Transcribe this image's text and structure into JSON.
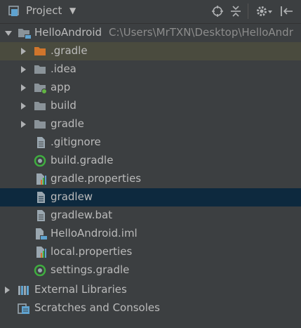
{
  "header": {
    "title": "Project",
    "dropdown_icon": "caret-down-icon",
    "tools": [
      "locate-icon",
      "collapse-all-icon",
      "gear-icon",
      "hide-panel-icon"
    ]
  },
  "tree": {
    "root": {
      "label": "HelloAndroid",
      "path": "C:\\Users\\MrTXN\\Desktop\\HelloAndr"
    },
    "items": [
      {
        "label": ".gradle",
        "icon": "folder-orange-icon"
      },
      {
        "label": ".idea",
        "icon": "folder-icon"
      },
      {
        "label": "app",
        "icon": "module-folder-icon"
      },
      {
        "label": "build",
        "icon": "folder-icon"
      },
      {
        "label": "gradle",
        "icon": "folder-icon"
      },
      {
        "label": ".gitignore",
        "icon": "text-file-icon"
      },
      {
        "label": "build.gradle",
        "icon": "gradle-file-icon"
      },
      {
        "label": "gradle.properties",
        "icon": "properties-file-icon"
      },
      {
        "label": "gradlew",
        "icon": "text-file-icon"
      },
      {
        "label": "gradlew.bat",
        "icon": "text-file-icon"
      },
      {
        "label": "HelloAndroid.iml",
        "icon": "iml-file-icon"
      },
      {
        "label": "local.properties",
        "icon": "properties-file-icon"
      },
      {
        "label": "settings.gradle",
        "icon": "gradle-file-icon"
      }
    ],
    "external_libraries": {
      "label": "External Libraries"
    },
    "scratches": {
      "label": "Scratches and Consoles"
    }
  },
  "colors": {
    "background": "#3c3f41",
    "selected_row": "#0d293e",
    "highlight_row": "#4a4b3e",
    "text": "#bbbbbb",
    "path_text": "#8c8c8c",
    "folder": "#8a9399",
    "orange_folder": "#d0752c",
    "gradle_green": "#3fae3f"
  }
}
